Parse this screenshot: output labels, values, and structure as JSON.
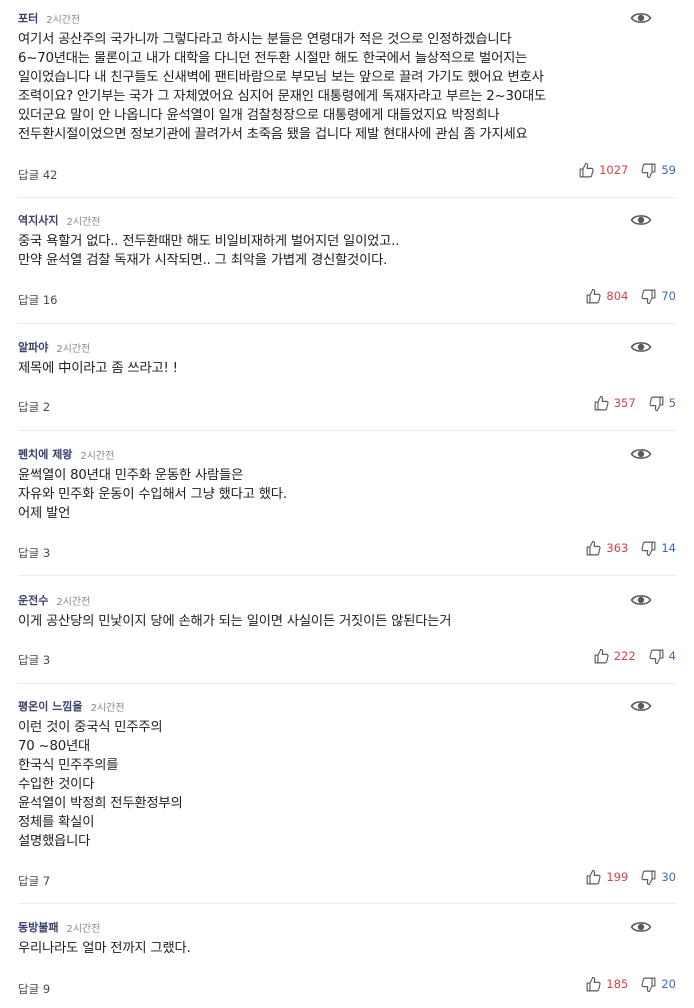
{
  "comments": [
    {
      "author": "포터",
      "time": "2시간전",
      "text": "여기서 공산주의 국가니까 그렇다라고 하시는 분들은 연령대가 적은 것으로 인정하겠습니다\n6~70년대는 물론이고 내가 대학을 다니던 전두환 시절만 해도 한국에서 늘상적으로 벌어지는\n일이었습니다 내 친구들도 신새벽에 팬티바람으로 부모님 보는 앞으로 끌려 가기도 했어요 변호사\n조력이요? 안기부는 국가 그 자체였어요 심지어 문재인 대통령에게 독재자라고 부르는 2~30대도\n있더군요 말이 안 나옵니다 윤석열이 일개 검찰청장으로 대통령에게 대들었지요 박정희나\n전두환시절이었으면 정보기관에 끌려가서 초죽음 됐을 겁니다 제발 현대사에 관심 좀 가지세요",
      "reply_label": "답글",
      "reply_count": "42",
      "likes": "1027",
      "dislikes": "59"
    },
    {
      "author": "역지사지",
      "time": "2시간전",
      "text": "중국 욕할거 없다..   전두환때만 해도 비일비재하게 벌어지던 일이었고..\n만약 윤석열 검찰 독재가 시작되면.. 그 최악을 가볍게 경신할것이다.",
      "reply_label": "답글",
      "reply_count": "16",
      "likes": "804",
      "dislikes": "70"
    },
    {
      "author": "알파야",
      "time": "2시간전",
      "text": "제목에 中이라고 좀 쓰라고! !",
      "reply_label": "답글",
      "reply_count": "2",
      "likes": "357",
      "dislikes": "5"
    },
    {
      "author": "펜치에 제왕",
      "time": "2시간전",
      "text": "윤썩열이 80년대 민주화 운동한 사람들은\n자유와 민주화 운동이 수입해서 그냥 했다고 했다.\n어제 발언",
      "reply_label": "답글",
      "reply_count": "3",
      "likes": "363",
      "dislikes": "14"
    },
    {
      "author": "운전수",
      "time": "2시간전",
      "text": "이게  공산당의  민낯이지    당에  손해가 되는  일이면  사실이든   거짓이든  않된다는거",
      "reply_label": "답글",
      "reply_count": "3",
      "likes": "222",
      "dislikes": "4"
    },
    {
      "author": "평온이 느낌을",
      "time": "2시간전",
      "text": "이런 것이 중국식 민주주의\n70 ~80년대\n한국식 민주주의를\n수입한 것이다\n윤석열이  박정희 전두환정부의\n정체를  확실이\n설명했읍니다",
      "reply_label": "답글",
      "reply_count": "7",
      "likes": "199",
      "dislikes": "30"
    },
    {
      "author": "동방불패",
      "time": "2시간전",
      "text": "우리나라도 얼마 전까지 그랬다.",
      "reply_label": "답글",
      "reply_count": "9",
      "likes": "185",
      "dislikes": "20"
    }
  ],
  "colors": {
    "author": "#3a3f6c",
    "like_count": "#d34545",
    "dislike_count": "#3d67c4",
    "icon": "#5a5a5a"
  },
  "icons": {
    "view": "eye-icon",
    "like": "thumbs-up-icon",
    "dislike": "thumbs-down-icon"
  }
}
